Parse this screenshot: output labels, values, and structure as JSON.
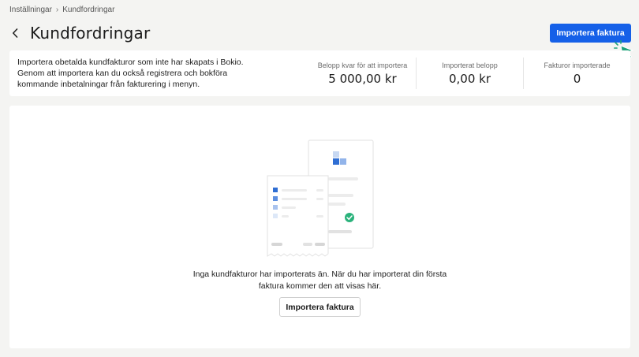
{
  "breadcrumb": {
    "parent": "Inställningar",
    "separator": "›",
    "current": "Kundfordringar"
  },
  "header": {
    "title": "Kundfordringar",
    "import_button": "Importera faktura"
  },
  "summary": {
    "description_lines": [
      "Importera obetalda kundfakturor som inte har skapats i Bokio.",
      "Genom att importera kan du också registrera och bokföra",
      "kommande inbetalningar från fakturering i menyn."
    ],
    "stats": [
      {
        "label": "Belopp kvar för att importera",
        "value": "5 000,00 kr"
      },
      {
        "label": "Importerat belopp",
        "value": "0,00 kr"
      },
      {
        "label": "Fakturor importerade",
        "value": "0"
      }
    ]
  },
  "empty_state": {
    "message_lines": [
      "Inga kundfakturor har importerats än. När du har importerat din första",
      "faktura kommer den att visas här."
    ],
    "import_button": "Importera faktura"
  },
  "colors": {
    "primary": "#1560e8",
    "success": "#2ab27b",
    "cursor": "#1fa37a"
  },
  "icons": [
    "chevron-left-icon",
    "receipt-illustration",
    "check-circle-icon",
    "pointer-cursor-icon"
  ]
}
